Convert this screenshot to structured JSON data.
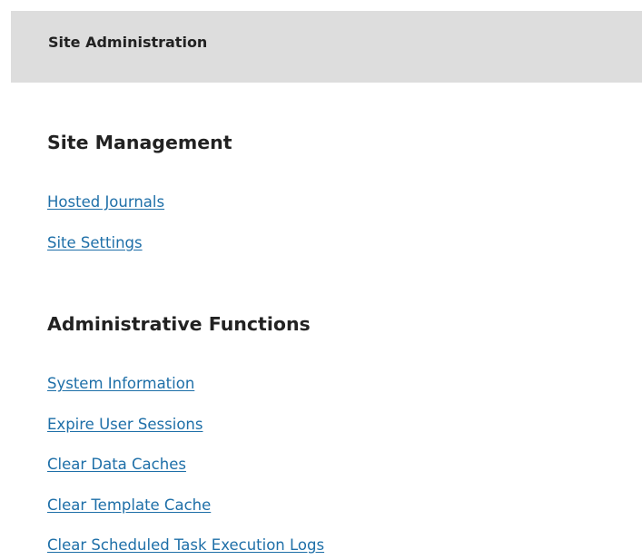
{
  "header": {
    "title": "Site Administration"
  },
  "sections": [
    {
      "heading": "Site Management",
      "links": [
        "Hosted Journals",
        "Site Settings"
      ]
    },
    {
      "heading": "Administrative Functions",
      "links": [
        "System Information",
        "Expire User Sessions",
        "Clear Data Caches",
        "Clear Template Cache",
        "Clear Scheduled Task Execution Logs"
      ]
    }
  ],
  "colors": {
    "link": "#1e6fa8",
    "header_background": "#dddddd",
    "heading_text": "#222222"
  }
}
